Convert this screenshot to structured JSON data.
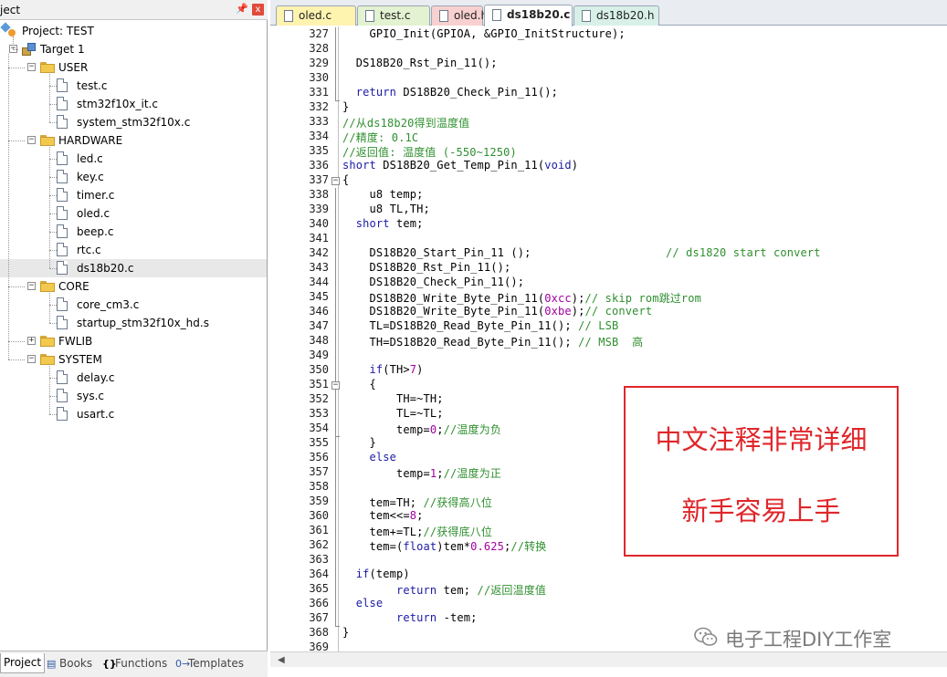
{
  "project_pane": {
    "title": "ject",
    "pin_icon": "pin-icon",
    "close_label": "x",
    "tree": [
      {
        "label": "Project: TEST",
        "kind": "project",
        "depth": 0,
        "expanded": true
      },
      {
        "label": "Target 1",
        "kind": "target",
        "depth": 1,
        "expanded": true
      },
      {
        "label": "USER",
        "kind": "folder",
        "depth": 2,
        "expanded": true
      },
      {
        "label": "test.c",
        "kind": "file",
        "depth": 3
      },
      {
        "label": "stm32f10x_it.c",
        "kind": "file",
        "depth": 3
      },
      {
        "label": "system_stm32f10x.c",
        "kind": "file",
        "depth": 3
      },
      {
        "label": "HARDWARE",
        "kind": "folder",
        "depth": 2,
        "expanded": true
      },
      {
        "label": "led.c",
        "kind": "file",
        "depth": 3
      },
      {
        "label": "key.c",
        "kind": "file",
        "depth": 3
      },
      {
        "label": "timer.c",
        "kind": "file",
        "depth": 3
      },
      {
        "label": "oled.c",
        "kind": "file",
        "depth": 3
      },
      {
        "label": "beep.c",
        "kind": "file",
        "depth": 3
      },
      {
        "label": "rtc.c",
        "kind": "file",
        "depth": 3
      },
      {
        "label": "ds18b20.c",
        "kind": "file",
        "depth": 3,
        "selected": true
      },
      {
        "label": "CORE",
        "kind": "folder",
        "depth": 2,
        "expanded": true
      },
      {
        "label": "core_cm3.c",
        "kind": "file",
        "depth": 3
      },
      {
        "label": "startup_stm32f10x_hd.s",
        "kind": "file",
        "depth": 3
      },
      {
        "label": "FWLIB",
        "kind": "folder",
        "depth": 2,
        "expanded": false
      },
      {
        "label": "SYSTEM",
        "kind": "folder",
        "depth": 2,
        "expanded": true
      },
      {
        "label": "delay.c",
        "kind": "file",
        "depth": 3
      },
      {
        "label": "sys.c",
        "kind": "file",
        "depth": 3
      },
      {
        "label": "usart.c",
        "kind": "file",
        "depth": 3
      }
    ],
    "bottom_tabs": [
      {
        "label": "Project",
        "icon": "project-icon",
        "active": true
      },
      {
        "label": "Books",
        "icon": "books-icon",
        "active": false
      },
      {
        "label": "Functions",
        "icon": "functions-icon",
        "glyph": "{}",
        "active": false
      },
      {
        "label": "Templates",
        "icon": "templates-icon",
        "glyph": "0→",
        "active": false
      }
    ]
  },
  "editor": {
    "tabs": [
      {
        "label": "oled.c",
        "color": "#fff3b0",
        "active": false
      },
      {
        "label": "test.c",
        "color": "#e3f2d0",
        "active": false
      },
      {
        "label": "oled.h",
        "color": "#f8d0d0",
        "active": false
      },
      {
        "label": "ds18b20.c",
        "color": "#ffffff",
        "active": true
      },
      {
        "label": "ds18b20.h",
        "color": "#d8f0e8",
        "active": false
      }
    ],
    "lines": [
      {
        "n": "327",
        "text": "    GPIO_Init(GPIOA, &GPIO_InitStructure);"
      },
      {
        "n": "328",
        "text": ""
      },
      {
        "n": "329",
        "text": "  DS18B20_Rst_Pin_11();"
      },
      {
        "n": "330",
        "text": ""
      },
      {
        "n": "331",
        "text": "  return DS18B20_Check_Pin_11();"
      },
      {
        "n": "332",
        "text": "}"
      },
      {
        "n": "333",
        "text": "//从ds18b20得到温度值"
      },
      {
        "n": "334",
        "text": "//精度: 0.1C"
      },
      {
        "n": "335",
        "text": "//返回值: 温度值 (-550~1250)"
      },
      {
        "n": "336",
        "text": "short DS18B20_Get_Temp_Pin_11(void)"
      },
      {
        "n": "337",
        "text": "{"
      },
      {
        "n": "338",
        "text": "    u8 temp;"
      },
      {
        "n": "339",
        "text": "    u8 TL,TH;"
      },
      {
        "n": "340",
        "text": "  short tem;"
      },
      {
        "n": "341",
        "text": ""
      },
      {
        "n": "342",
        "text": "    DS18B20_Start_Pin_11 ();                    // ds1820 start convert"
      },
      {
        "n": "343",
        "text": "    DS18B20_Rst_Pin_11();"
      },
      {
        "n": "344",
        "text": "    DS18B20_Check_Pin_11();"
      },
      {
        "n": "345",
        "text": "    DS18B20_Write_Byte_Pin_11(0xcc);// skip rom跳过rom"
      },
      {
        "n": "346",
        "text": "    DS18B20_Write_Byte_Pin_11(0xbe);// convert"
      },
      {
        "n": "347",
        "text": "    TL=DS18B20_Read_Byte_Pin_11(); // LSB"
      },
      {
        "n": "348",
        "text": "    TH=DS18B20_Read_Byte_Pin_11(); // MSB  高"
      },
      {
        "n": "349",
        "text": ""
      },
      {
        "n": "350",
        "text": "    if(TH>7)"
      },
      {
        "n": "351",
        "text": "    {"
      },
      {
        "n": "352",
        "text": "        TH=~TH;"
      },
      {
        "n": "353",
        "text": "        TL=~TL;"
      },
      {
        "n": "354",
        "text": "        temp=0;//温度为负"
      },
      {
        "n": "355",
        "text": "    }"
      },
      {
        "n": "356",
        "text": "    else"
      },
      {
        "n": "357",
        "text": "        temp=1;//温度为正"
      },
      {
        "n": "358",
        "text": ""
      },
      {
        "n": "359",
        "text": "    tem=TH; //获得高八位"
      },
      {
        "n": "360",
        "text": "    tem<<=8;"
      },
      {
        "n": "361",
        "text": "    tem+=TL;//获得底八位"
      },
      {
        "n": "362",
        "text": "    tem=(float)tem*0.625;//转换"
      },
      {
        "n": "363",
        "text": ""
      },
      {
        "n": "364",
        "text": "  if(temp)"
      },
      {
        "n": "365",
        "text": "        return tem; //返回温度值"
      },
      {
        "n": "366",
        "text": "  else"
      },
      {
        "n": "367",
        "text": "        return -tem;"
      },
      {
        "n": "368",
        "text": "}"
      },
      {
        "n": "369",
        "text": ""
      }
    ]
  },
  "callout": {
    "line1": "中文注释非常详细",
    "line2": "新手容易上手",
    "color": "#e0262a"
  },
  "watermark": {
    "text": "电子工程DIY工作室",
    "icon": "wechat-icon"
  }
}
